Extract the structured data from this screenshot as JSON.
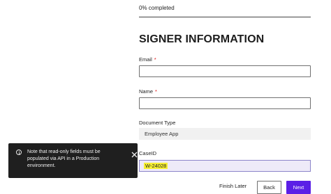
{
  "progress": {
    "label": "0% completed",
    "percent": 0
  },
  "section_title": "SIGNER INFORMATION",
  "fields": {
    "email": {
      "label": "Email",
      "required_mark": "*",
      "value": ""
    },
    "name": {
      "label": "Name",
      "required_mark": "*",
      "value": ""
    },
    "document_type": {
      "label": "Document Type",
      "value": "Employee App"
    },
    "case_id": {
      "label": "CaseID",
      "value": "W-24028"
    }
  },
  "toast": {
    "message": "Note that read-only fields must be populated via API in a Production environment.",
    "icon": "info-icon",
    "close_icon": "close-icon"
  },
  "footer": {
    "finish_later_label": "Finish Later",
    "back_label": "Back",
    "next_label": "Next"
  },
  "colors": {
    "accent": "#5b1fe6",
    "toast_bg": "#1f1f1f",
    "highlight": "#f7f032",
    "required": "#d11111"
  }
}
